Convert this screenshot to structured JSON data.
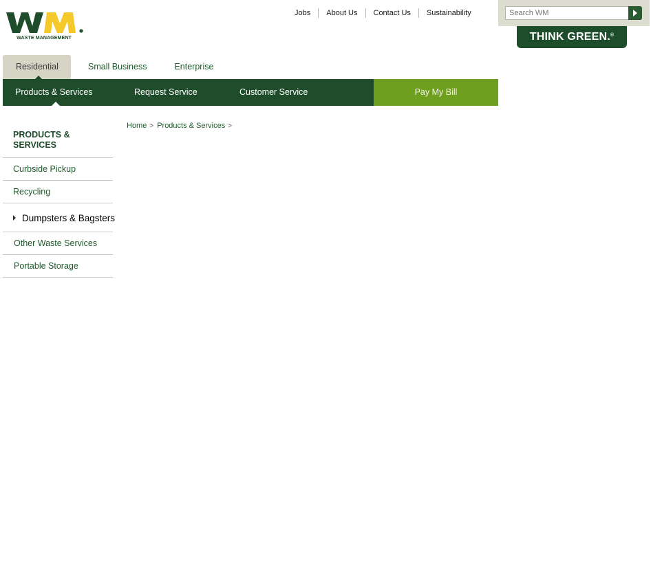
{
  "brand": {
    "logo_letters": "WM",
    "logo_tagline": "WASTE MANAGEMENT",
    "colors": {
      "dark_green": "#1f4d2b",
      "yellow": "#f5c92a",
      "light_green": "#6f9f1f",
      "tab_bg": "#d5d4c5"
    }
  },
  "utility_links": [
    "Jobs",
    "About Us",
    "Contact Us",
    "Sustainability"
  ],
  "search": {
    "placeholder": "Search WM",
    "button_icon": "arrow-right-icon"
  },
  "think_green": {
    "text": "THINK GREEN.",
    "mark": "®"
  },
  "audience_tabs": [
    {
      "label": "Residential",
      "active": true
    },
    {
      "label": "Small Business",
      "active": false
    },
    {
      "label": "Enterprise",
      "active": false
    }
  ],
  "main_nav": {
    "items": [
      "Products & Services",
      "Request Service",
      "Customer Service"
    ],
    "pay_bill": "Pay My Bill"
  },
  "sidebar": {
    "title_line1": "PRODUCTS &",
    "title_line2": "SERVICES",
    "items": [
      {
        "label": "Curbside Pickup"
      },
      {
        "label": "Recycling"
      },
      {
        "label": "Dumpsters & Bagsters",
        "selected": true
      },
      {
        "label": "Other Waste Services"
      },
      {
        "label": "Portable Storage"
      }
    ]
  },
  "breadcrumb": [
    {
      "label": "Home",
      "sep": ">"
    },
    {
      "label": "Products & Services",
      "sep": ">"
    }
  ]
}
